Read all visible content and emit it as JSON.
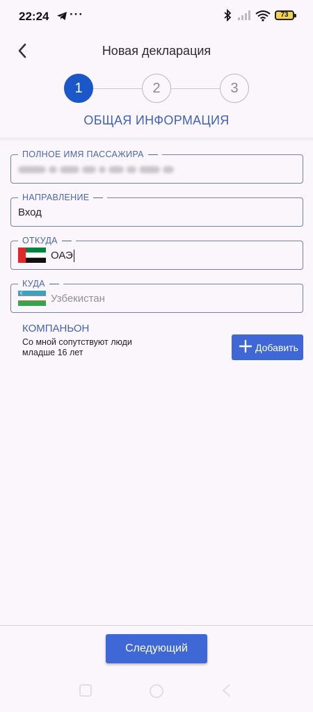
{
  "status_bar": {
    "time": "22:24",
    "more": "···",
    "battery": "73",
    "icons": [
      "telegram-icon",
      "bluetooth-icon",
      "signal-icon",
      "wifi-icon",
      "battery-icon"
    ]
  },
  "header": {
    "title": "Новая декларация",
    "back_icon": "back-arrow-icon"
  },
  "stepper": {
    "steps": [
      "1",
      "2",
      "3"
    ],
    "current": 1
  },
  "section_title": "ОБЩАЯ ИНФОРМАЦИЯ",
  "form": {
    "passenger_name": {
      "label": "ПОЛНОЕ ИМЯ ПАССАЖИРА"
    },
    "direction": {
      "label": "НАПРАВЛЕНИЕ",
      "value": "Вход"
    },
    "from": {
      "label": "ОТКУДА",
      "value": "ОАЭ",
      "flag": "uae-flag"
    },
    "to": {
      "label": "КУДА",
      "placeholder": "Узбекистан",
      "flag": "uzbekistan-flag"
    }
  },
  "companion": {
    "title": "КОМПАНЬОН",
    "description": "Со мной сопутствуют люди младше 16 лет",
    "add_button": "Добавить"
  },
  "next_button": "Следующий",
  "colors": {
    "primary": "#3f68d6",
    "step_active": "#1a57c9",
    "accent_text": "#3f63b8",
    "background": "#fbf6fb"
  }
}
